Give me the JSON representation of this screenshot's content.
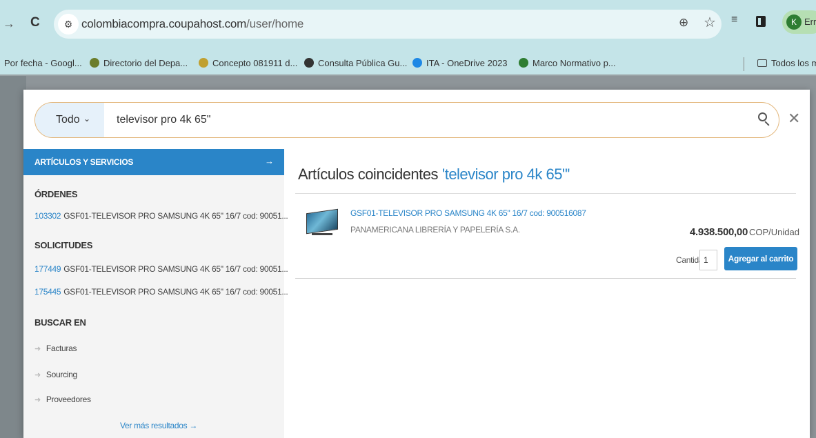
{
  "browser": {
    "url_host": "colombiacompra.coupahost.com",
    "url_path": "/user/home",
    "profile_initial": "K",
    "profile_label": "Err",
    "icons": [
      "forward-icon",
      "reload-icon",
      "site-controls-icon",
      "zoom-icon",
      "star-icon",
      "reading-list-icon",
      "side-panel-icon"
    ]
  },
  "bookmarks": [
    {
      "label": "Por fecha - Googl...",
      "color": ""
    },
    {
      "label": "Directorio del Depa...",
      "color": "#6b7d2a"
    },
    {
      "label": "Concepto 081911 d...",
      "color": "#c0a030"
    },
    {
      "label": "Consulta Pública Gu...",
      "color": "#333333"
    },
    {
      "label": "ITA - OneDrive 2023",
      "color": "#1e88e5"
    },
    {
      "label": "Marco Normativo p...",
      "color": "#2e7d32"
    }
  ],
  "bookmarks_folder": "Todos los m",
  "search": {
    "scope": "Todo",
    "query": "televisor pro 4k 65\""
  },
  "left_panel": {
    "header": "ARTÍCULOS Y SERVICIOS",
    "header_arrow": "→",
    "ordenes_title": "ÓRDENES",
    "ordenes": [
      {
        "id": "103302",
        "text": "GSF01-TELEVISOR PRO SAMSUNG 4K 65\" 16/7 cod: 90051..."
      }
    ],
    "solicitudes_title": "SOLICITUDES",
    "solicitudes": [
      {
        "id": "177449",
        "text": "GSF01-TELEVISOR PRO SAMSUNG 4K 65\" 16/7 cod: 90051..."
      },
      {
        "id": "175445",
        "text": "GSF01-TELEVISOR PRO SAMSUNG 4K 65\" 16/7 cod: 90051..."
      }
    ],
    "buscar_title": "BUSCAR EN",
    "buscar_en": [
      "Facturas",
      "Sourcing",
      "Proveedores"
    ],
    "more_link": "Ver más resultados →"
  },
  "results": {
    "title": "Artículos coincidentes",
    "query_label": "'televisor pro 4k 65\"'",
    "item": {
      "name": "GSF01-TELEVISOR PRO SAMSUNG 4K 65\" 16/7 cod: 900516087",
      "vendor": "PANAMERICANA LIBRERÍA Y PAPELERÍA S.A.",
      "price": "4.938.500,00",
      "unit": "COP/Unidad",
      "qty_label": "Cantidad",
      "qty_value": "1",
      "add_button": "Agregar al carrito"
    }
  },
  "colors": {
    "accent": "#2a85c8",
    "chrome": "#c4e4e8",
    "search_border": "#e3b77c"
  }
}
